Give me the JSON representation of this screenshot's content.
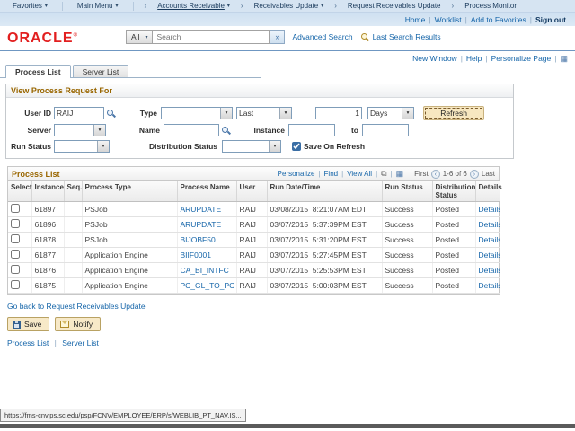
{
  "branding": {
    "logo": "ORACLE",
    "registered": "®"
  },
  "ui": {
    "sep": "|",
    "chevron_down": "▾",
    "crumb_sep": "›",
    "go": "»",
    "grid_icon": "▦",
    "popup_icon": "⧉",
    "prev": "‹",
    "next": "›"
  },
  "colors": {
    "accent_blue": "#1565a9",
    "brand_red": "#e21f1f",
    "section_title_brown": "#996600",
    "bar_blue": "#d6e4f2"
  },
  "nav": {
    "favorites": "Favorites",
    "main_menu": "Main Menu",
    "crumbs": [
      {
        "label": "Accounts Receivable"
      },
      {
        "label": "Receivables Update"
      },
      {
        "label": "Request Receivables Update"
      },
      {
        "label": "Process Monitor"
      }
    ],
    "header_links": {
      "home": "Home",
      "worklist": "Worklist",
      "add_to_favorites": "Add to Favorites"
    },
    "sign_out": "Sign out",
    "page_links": {
      "new_window": "New Window",
      "help": "Help",
      "personalize_page": "Personalize Page"
    }
  },
  "search": {
    "scope": "All",
    "placeholder": "Search",
    "advanced": "Advanced Search",
    "last_results": "Last Search Results"
  },
  "tabs": {
    "process_list": "Process List",
    "server_list": "Server List"
  },
  "filter": {
    "title": "View Process Request For",
    "user_id_label": "User ID",
    "user_id_value": "RAIJ",
    "type_label": "Type",
    "last_value": "Last",
    "last_num": "1",
    "days_value": "Days",
    "refresh": "Refresh",
    "server_label": "Server",
    "name_label": "Name",
    "instance_label": "Instance",
    "to_label": "to",
    "run_status_label": "Run Status",
    "dist_status_label": "Distribution Status",
    "save_on_refresh": "Save On Refresh",
    "save_on_refresh_checked": true
  },
  "grid": {
    "title": "Process List",
    "toolbar": {
      "personalize": "Personalize",
      "find": "Find",
      "view_all": "View All"
    },
    "pager": {
      "first": "First",
      "range": "1-6 of 6",
      "last": "Last"
    },
    "columns": [
      "Select",
      "Instance",
      "Seq.",
      "Process Type",
      "Process Name",
      "User",
      "Run Date/Time",
      "Run Status",
      "Distribution Status",
      "Details"
    ],
    "rows": [
      {
        "instance": "61897",
        "seq": "",
        "type": "PSJob",
        "name": "ARUPDATE",
        "user": "RAIJ",
        "datetime": "03/08/2015  8:21:07AM EDT",
        "status": "Success",
        "dist": "Posted",
        "details": "Details"
      },
      {
        "instance": "61896",
        "seq": "",
        "type": "PSJob",
        "name": "ARUPDATE",
        "user": "RAIJ",
        "datetime": "03/07/2015  5:37:39PM EST",
        "status": "Success",
        "dist": "Posted",
        "details": "Details"
      },
      {
        "instance": "61878",
        "seq": "",
        "type": "PSJob",
        "name": "BIJOBF50",
        "user": "RAIJ",
        "datetime": "03/07/2015  5:31:20PM EST",
        "status": "Success",
        "dist": "Posted",
        "details": "Details"
      },
      {
        "instance": "61877",
        "seq": "",
        "type": "Application Engine",
        "name": "BIIF0001",
        "user": "RAIJ",
        "datetime": "03/07/2015  5:27:45PM EST",
        "status": "Success",
        "dist": "Posted",
        "details": "Details"
      },
      {
        "instance": "61876",
        "seq": "",
        "type": "Application Engine",
        "name": "CA_BI_INTFC",
        "user": "RAIJ",
        "datetime": "03/07/2015  5:25:53PM EST",
        "status": "Success",
        "dist": "Posted",
        "details": "Details"
      },
      {
        "instance": "61875",
        "seq": "",
        "type": "Application Engine",
        "name": "PC_GL_TO_PC",
        "user": "RAIJ",
        "datetime": "03/07/2015  5:00:03PM EST",
        "status": "Success",
        "dist": "Posted",
        "details": "Details"
      }
    ]
  },
  "footer": {
    "go_back": "Go back to Request Receivables Update",
    "save": "Save",
    "notify": "Notify",
    "process_list_link": "Process List",
    "server_list_link": "Server List"
  },
  "statusbar": {
    "url": "https://fms-cnv.ps.sc.edu/psp/FCNV/EMPLOYEE/ERP/s/WEBLIB_PT_NAV.IS..."
  }
}
